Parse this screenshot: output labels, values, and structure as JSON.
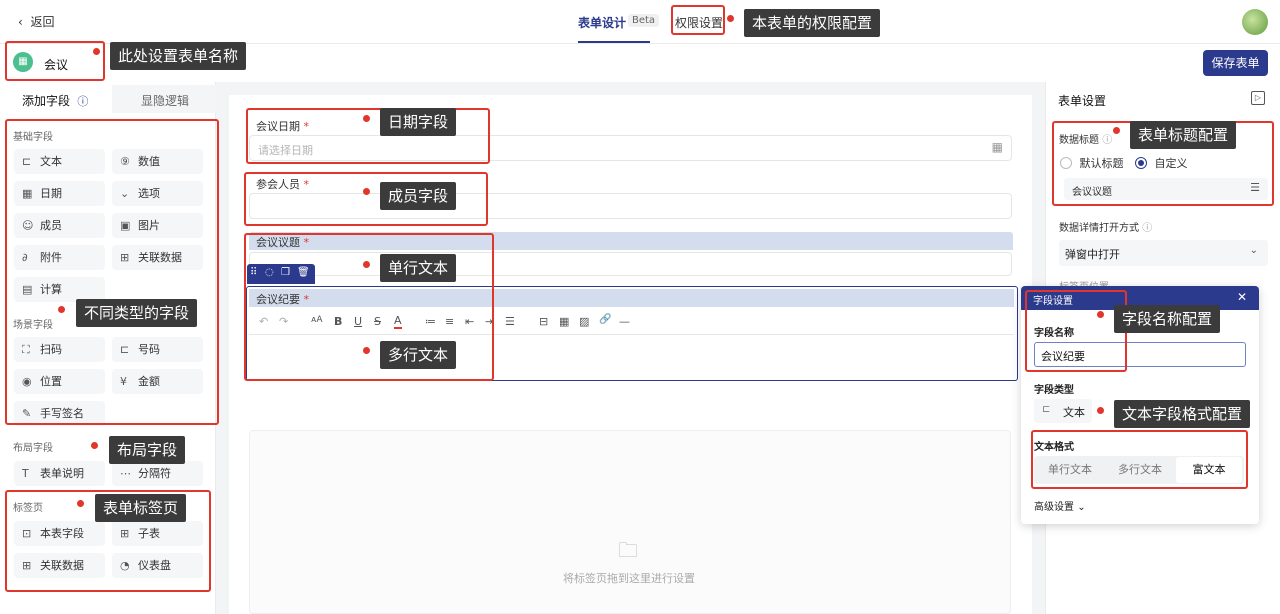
{
  "topbar": {
    "back_label": "返回",
    "back_icon": "chevron-left-icon",
    "tabs": [
      {
        "label": "表单设计",
        "active": true,
        "badge": "Beta"
      },
      {
        "label": "权限设置",
        "active": false
      }
    ]
  },
  "form": {
    "name": "会议",
    "icon": "calendar-icon",
    "save_label": "保存表单"
  },
  "left_panel": {
    "tabs": [
      {
        "label": "添加字段",
        "active": true,
        "icon": "help-circle-icon"
      },
      {
        "label": "显隐逻辑",
        "active": false
      }
    ],
    "sections": [
      {
        "title": "基础字段",
        "items": [
          {
            "label": "文本",
            "icon": "text-field-icon",
            "glyph": "⊏"
          },
          {
            "label": "数值",
            "icon": "number-icon",
            "glyph": "⑨"
          },
          {
            "label": "日期",
            "icon": "calendar-icon",
            "glyph": "▦"
          },
          {
            "label": "选项",
            "icon": "chevron-circle-icon",
            "glyph": "⌄"
          },
          {
            "label": "成员",
            "icon": "member-icon",
            "glyph": "☺"
          },
          {
            "label": "图片",
            "icon": "image-icon",
            "glyph": "▣"
          },
          {
            "label": "附件",
            "icon": "paperclip-icon",
            "glyph": "∂"
          },
          {
            "label": "关联数据",
            "icon": "linked-data-icon",
            "glyph": "⊞"
          },
          {
            "label": "计算",
            "icon": "calculator-icon",
            "glyph": "▤"
          }
        ]
      },
      {
        "title": "场景字段",
        "items": [
          {
            "label": "扫码",
            "icon": "scan-icon",
            "glyph": "⛶"
          },
          {
            "label": "号码",
            "icon": "number-tag-icon",
            "glyph": "⊏"
          },
          {
            "label": "位置",
            "icon": "location-icon",
            "glyph": "◉"
          },
          {
            "label": "金额",
            "icon": "currency-icon",
            "glyph": "¥"
          },
          {
            "label": "手写签名",
            "icon": "signature-icon",
            "glyph": "✎"
          }
        ]
      },
      {
        "title": "布局字段",
        "items": [
          {
            "label": "表单说明",
            "icon": "text-t-icon",
            "glyph": "T"
          },
          {
            "label": "分隔符",
            "icon": "ellipsis-icon",
            "glyph": "⋯"
          }
        ]
      },
      {
        "title": "标签页",
        "items": [
          {
            "label": "本表字段",
            "icon": "form-fields-icon",
            "glyph": "⊡"
          },
          {
            "label": "子表",
            "icon": "table-icon",
            "glyph": "⊞"
          },
          {
            "label": "关联数据",
            "icon": "linked-data-icon",
            "glyph": "⊞"
          },
          {
            "label": "仪表盘",
            "icon": "dashboard-icon",
            "glyph": "◔"
          }
        ]
      }
    ]
  },
  "canvas": {
    "fields": [
      {
        "label": "会议日期",
        "required": true,
        "placeholder": "请选择日期",
        "type": "date",
        "icon": "calendar-icon"
      },
      {
        "label": "参会人员",
        "required": true,
        "type": "member"
      },
      {
        "label": "会议议题",
        "required": true,
        "type": "single-line"
      },
      {
        "label": "会议纪要",
        "required": true,
        "type": "rich-text"
      }
    ],
    "rich_toolbar_glyphs": [
      "↶",
      "↷",
      "ᴀA",
      "B",
      "U",
      "S",
      "A",
      "≔",
      "≡",
      "⇤",
      "⇥",
      "☰",
      "⊟",
      "▦",
      "▨",
      "🔗",
      "—"
    ],
    "tab_drop_text": "将标签页拖到这里进行设置",
    "tab_drop_icon": "folder-add-icon"
  },
  "right_panel": {
    "title": "表单设置",
    "collapse_icon": "panel-collapse-icon",
    "data_title_label": "数据标题",
    "data_title_options": [
      {
        "label": "默认标题",
        "selected": false
      },
      {
        "label": "自定义",
        "selected": true
      }
    ],
    "data_title_value": "会议议题",
    "detail_open_label": "数据详情打开方式",
    "detail_open_value": "弹窗中打开",
    "tab_position_label": "标签页位置"
  },
  "field_settings": {
    "title": "字段设置",
    "name_label": "字段名称",
    "name_value": "会议纪要",
    "type_label": "字段类型",
    "type_value": "文本",
    "format_label": "文本格式",
    "formats": [
      {
        "label": "单行文本",
        "selected": false
      },
      {
        "label": "多行文本",
        "selected": false
      },
      {
        "label": "富文本",
        "selected": true
      }
    ],
    "advanced_label": "高级设置"
  },
  "annotations": [
    "本表单的权限配置",
    "此处设置表单名称",
    "日期字段",
    "成员字段",
    "单行文本",
    "多行文本",
    "不同类型的字段",
    "布局字段",
    "表单标签页",
    "表单标题配置",
    "字段名称配置",
    "文本字段格式配置"
  ]
}
